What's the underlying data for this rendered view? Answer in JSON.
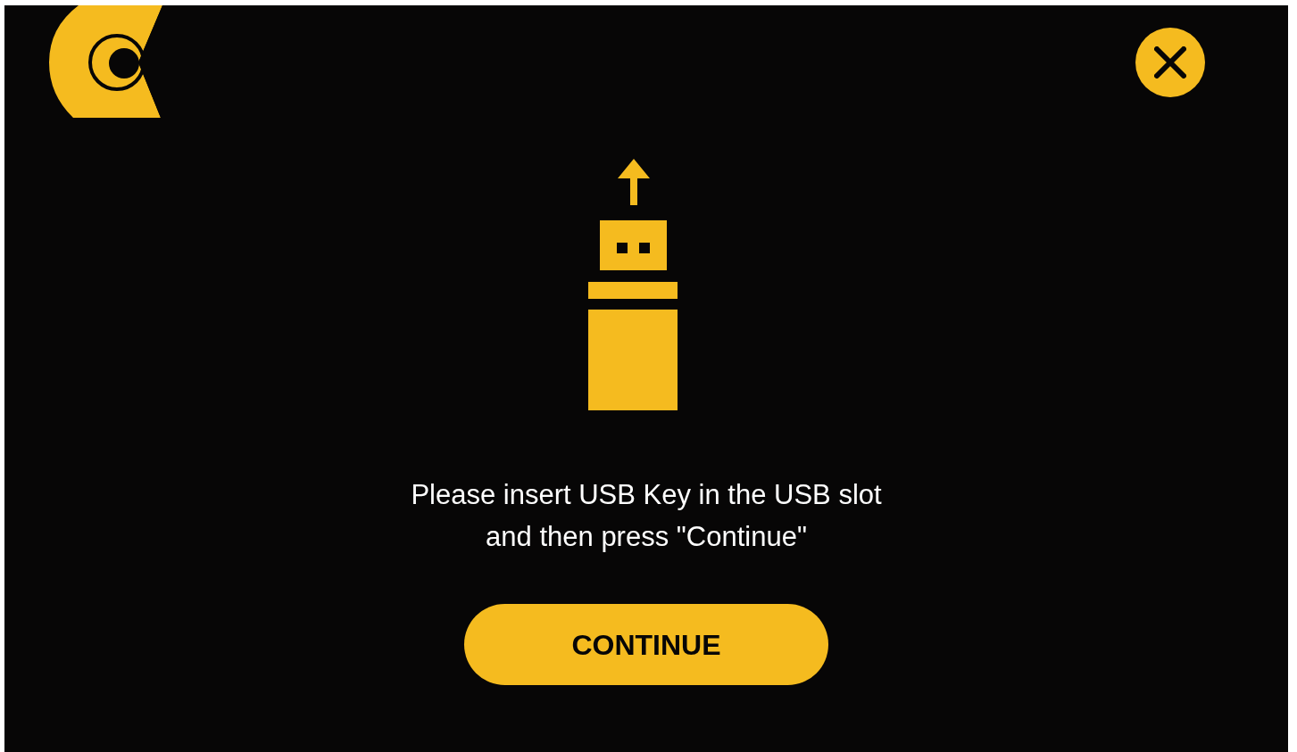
{
  "message_lines": [
    "Please insert USB Key in the USB slot",
    "and then press \"Continue\""
  ],
  "continue_button": {
    "label": "CONTINUE"
  }
}
